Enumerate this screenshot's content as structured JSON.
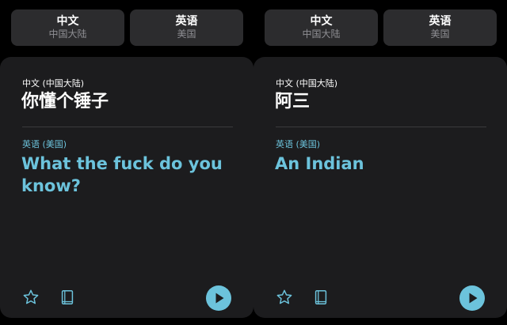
{
  "colors": {
    "background": "#000000",
    "card": "#1c1c1e",
    "button": "#2c2c2e",
    "accent": "#6cc3dc",
    "secondary_text": "#8e8e93",
    "divider": "#3a3a3c"
  },
  "panels": [
    {
      "source_lang": {
        "name": "中文",
        "region": "中国大陆"
      },
      "target_lang": {
        "name": "英语",
        "region": "美国"
      },
      "card": {
        "source_label": "中文 (中国大陆)",
        "source_text": "你懂个锤子",
        "target_label": "英语 (美国)",
        "target_text": "What the fuck do you know?"
      },
      "icons": {
        "favorite": "star-icon",
        "dictionary": "book-icon",
        "play": "play-icon"
      }
    },
    {
      "source_lang": {
        "name": "中文",
        "region": "中国大陆"
      },
      "target_lang": {
        "name": "英语",
        "region": "美国"
      },
      "card": {
        "source_label": "中文 (中国大陆)",
        "source_text": "阿三",
        "target_label": "英语 (美国)",
        "target_text": "An Indian"
      },
      "icons": {
        "favorite": "star-icon",
        "dictionary": "book-icon",
        "play": "play-icon"
      }
    }
  ]
}
